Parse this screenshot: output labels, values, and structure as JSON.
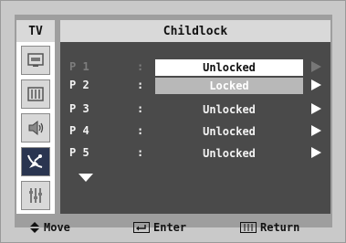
{
  "tv_label": "TV",
  "title": "Childlock",
  "rows": [
    {
      "channel": "P 1",
      "colon": ":",
      "value": "Unlocked"
    },
    {
      "channel": "P 2",
      "colon": ":",
      "value": "Locked"
    },
    {
      "channel": "P 3",
      "colon": ":",
      "value": "Unlocked"
    },
    {
      "channel": "P 4",
      "colon": ":",
      "value": "Unlocked"
    },
    {
      "channel": "P 5",
      "colon": ":",
      "value": "Unlocked"
    }
  ],
  "footer": {
    "move": "Move",
    "enter": "Enter",
    "return": "Return"
  },
  "sidebar_icons": [
    "input-icon",
    "picture-icon",
    "sound-icon",
    "channel-icon",
    "setup-icon"
  ]
}
